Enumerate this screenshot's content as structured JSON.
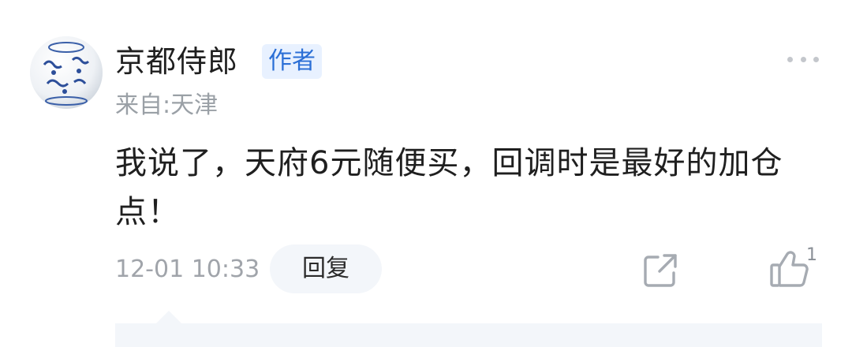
{
  "comment": {
    "username": "京都侍郎",
    "author_tag": "作者",
    "location": "来自:天津",
    "content": "我说了，天府6元随便买，回调时是最好的加仓点！",
    "timestamp": "12-01 10:33",
    "reply_label": "回复",
    "like_count": "1"
  },
  "icons": {
    "avatar": "porcelain-avatar",
    "more": "more-dots-icon",
    "share": "share-icon",
    "like": "thumbs-up-icon"
  },
  "colors": {
    "accent": "#2b6fd6",
    "tag_bg": "#e8f1ff",
    "muted_text": "#9aa0a6",
    "panel_bg": "#f3f6fa"
  }
}
